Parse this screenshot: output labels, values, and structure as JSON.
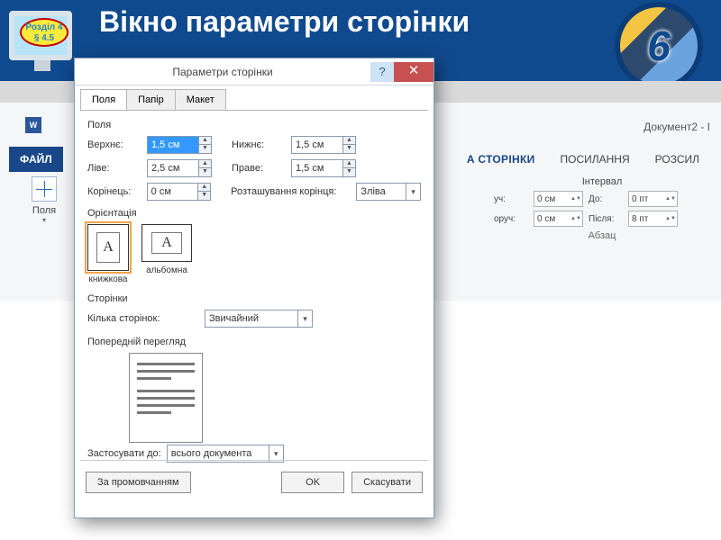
{
  "slide": {
    "title": "Вікно параметри сторінки",
    "chapter_line1": "Розділ 4",
    "chapter_line2": "§ 4.5",
    "grade": "6"
  },
  "word": {
    "doc_title": "Документ2 - I",
    "tabs": {
      "file": "ФАЙЛ",
      "layout": "А СТОРІНКИ",
      "references": "ПОСИЛАННЯ",
      "mailings": "РОЗСИЛ"
    },
    "polya_btn": "Поля",
    "interval_title": "Інтервал",
    "interval": {
      "left_lbl": "уч:",
      "left_val": "0 см",
      "right_lbl": "оруч:",
      "right_val": "0 см",
      "before_lbl": "До:",
      "before_val": "0 пт",
      "after_lbl": "Після:",
      "after_val": "8 пт"
    },
    "abzats": "Абзац"
  },
  "dialog": {
    "title": "Параметри сторінки",
    "tabs": {
      "fields": "Поля",
      "paper": "Папір",
      "layout": "Макет"
    },
    "section_fields": "Поля",
    "margins": {
      "top_lbl": "Верхнє:",
      "top_val": "1,5 см",
      "bottom_lbl": "Нижнє:",
      "bottom_val": "1,5 см",
      "left_lbl": "Ліве:",
      "left_val": "2,5 см",
      "right_lbl": "Праве:",
      "right_val": "1,5 см",
      "gutter_lbl": "Корінець:",
      "gutter_val": "0 см",
      "gutterpos_lbl": "Розташування корінця:",
      "gutterpos_val": "Зліва"
    },
    "section_orient": "Орієнтація",
    "orient": {
      "portrait": "книжкова",
      "landscape": "альбомна"
    },
    "section_pages": "Сторінки",
    "pages_lbl": "Кілька сторінок:",
    "pages_val": "Звичайний",
    "section_preview": "Попередній перегляд",
    "apply_lbl": "Застосувати до:",
    "apply_val": "всього документа",
    "btn_default": "За промовчанням",
    "btn_ok": "OK",
    "btn_cancel": "Скасувати"
  }
}
